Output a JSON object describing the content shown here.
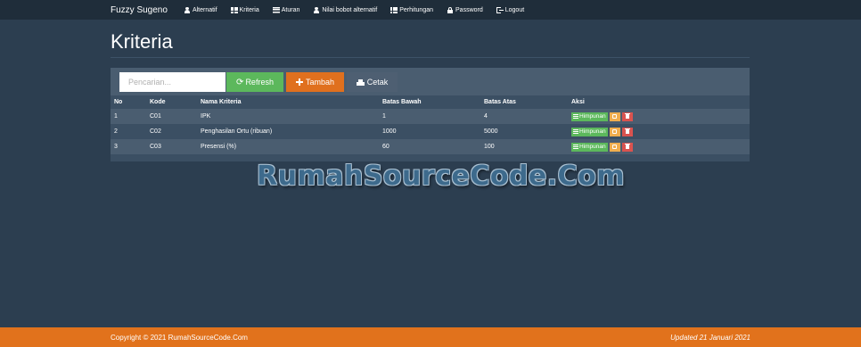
{
  "navbar": {
    "brand": "Fuzzy Sugeno",
    "items": [
      {
        "label": "Alternatif",
        "icon": "user-icon"
      },
      {
        "label": "Kriteria",
        "icon": "grid-icon"
      },
      {
        "label": "Aturan",
        "icon": "lines-icon"
      },
      {
        "label": "Nilai bobot alternatif",
        "icon": "user-icon"
      },
      {
        "label": "Perhitungan",
        "icon": "list-icon"
      },
      {
        "label": "Password",
        "icon": "lock-icon"
      },
      {
        "label": "Logout",
        "icon": "logout-icon"
      }
    ]
  },
  "page": {
    "title": "Kriteria"
  },
  "toolbar": {
    "search_placeholder": "Pencarian...",
    "refresh_label": "Refresh",
    "tambah_label": "Tambah",
    "cetak_label": "Cetak"
  },
  "table": {
    "headers": [
      "No",
      "Kode",
      "Nama Kriteria",
      "Batas Bawah",
      "Batas Atas",
      "Aksi"
    ],
    "action_label": "Himpunan",
    "rows": [
      {
        "no": "1",
        "kode": "C01",
        "nama": "IPK",
        "bawah": "1",
        "atas": "4"
      },
      {
        "no": "2",
        "kode": "C02",
        "nama": "Penghasilan Ortu (ribuan)",
        "bawah": "1000",
        "atas": "5000"
      },
      {
        "no": "3",
        "kode": "C03",
        "nama": "Presensi (%)",
        "bawah": "60",
        "atas": "100"
      }
    ]
  },
  "watermark": "RumahSourceCode.Com",
  "footer": {
    "copyright": "Copyright © 2021 RumahSourceCode.Com",
    "updated": "Updated 21 Januari 2021"
  },
  "colors": {
    "background": "#2c3e50",
    "navbar": "#1f2d3a",
    "footer": "#e1721c",
    "success": "#5cb85c",
    "warning": "#f0ad4e",
    "danger": "#d9534f",
    "orange": "#e0701e"
  }
}
